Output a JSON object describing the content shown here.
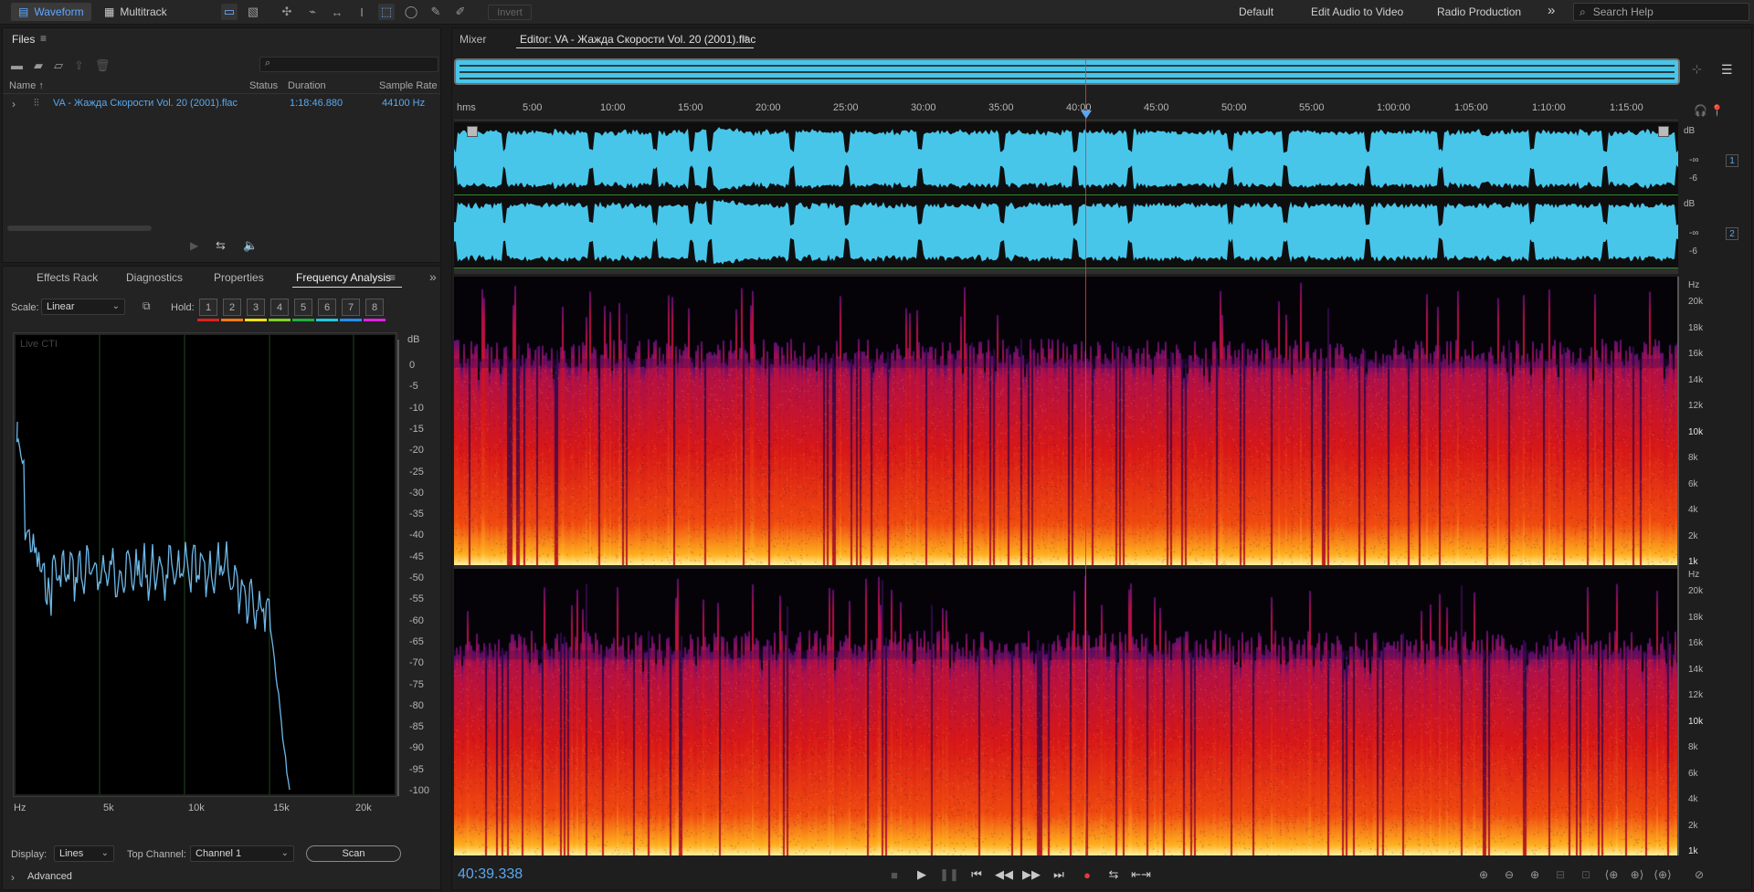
{
  "topbar": {
    "waveform_label": "Waveform",
    "multitrack_label": "Multitrack",
    "invert_label": "Invert",
    "workspaces": [
      "Default",
      "Edit Audio to Video",
      "Radio Production"
    ],
    "more_glyph": "»",
    "search_placeholder": "Search Help"
  },
  "files": {
    "title": "Files",
    "menu_glyph": "≡",
    "columns": {
      "name": "Name",
      "status": "Status",
      "duration": "Duration",
      "sample_rate": "Sample Rate"
    },
    "sort_glyph": "↑",
    "row": {
      "name": "VA - Жажда Скорости Vol. 20 (2001).flac",
      "duration": "1:18:46.880",
      "sample_rate": "44100 Hz"
    }
  },
  "analysis": {
    "tabs": [
      "Effects Rack",
      "Diagnostics",
      "Properties",
      "Frequency Analysis"
    ],
    "scale_label": "Scale:",
    "scale_value": "Linear",
    "hold_label": "Hold:",
    "holds": [
      "1",
      "2",
      "3",
      "4",
      "5",
      "6",
      "7",
      "8"
    ],
    "hold_colors": [
      "#e0201c",
      "#f07a10",
      "#f0e010",
      "#80d020",
      "#20b040",
      "#20c8e0",
      "#2090ff",
      "#e020e0"
    ],
    "live_label": "Live CTI",
    "db_unit": "dB",
    "db_ticks": [
      "0",
      "-5",
      "-10",
      "-15",
      "-20",
      "-25",
      "-30",
      "-35",
      "-40",
      "-45",
      "-50",
      "-55",
      "-60",
      "-65",
      "-70",
      "-75",
      "-80",
      "-85",
      "-90",
      "-95",
      "-100"
    ],
    "freq_unit": "Hz",
    "freq_ticks": [
      "5k",
      "10k",
      "15k",
      "20k"
    ],
    "display_label": "Display:",
    "display_value": "Lines",
    "top_channel_label": "Top Channel:",
    "top_channel_value": "Channel 1",
    "scan_label": "Scan",
    "advanced_label": "Advanced",
    "line_color": "#6db8e8"
  },
  "editor": {
    "mixer_label": "Mixer",
    "title": "Editor: VA - Жажда Скорости Vol. 20 (2001).flac",
    "ruler_unit": "hms",
    "ruler_ticks": [
      "5:00",
      "10:00",
      "15:00",
      "20:00",
      "25:00",
      "30:00",
      "35:00",
      "40:00",
      "45:00",
      "50:00",
      "55:00",
      "1:00:00",
      "1:05:00",
      "1:10:00",
      "1:15:00"
    ],
    "db_label": "dB",
    "db_minus_inf": "-∞",
    "db_minus6": "-6",
    "channels": [
      "1",
      "2"
    ],
    "hz_label": "Hz",
    "hz_ticks": [
      "20k",
      "18k",
      "16k",
      "14k",
      "12k",
      "10k",
      "8k",
      "6k",
      "4k",
      "2k",
      "1k"
    ],
    "waveform_color": "#47c6ea",
    "playhead_color": "#e23b3b"
  },
  "transport": {
    "time": "40:39.338"
  }
}
